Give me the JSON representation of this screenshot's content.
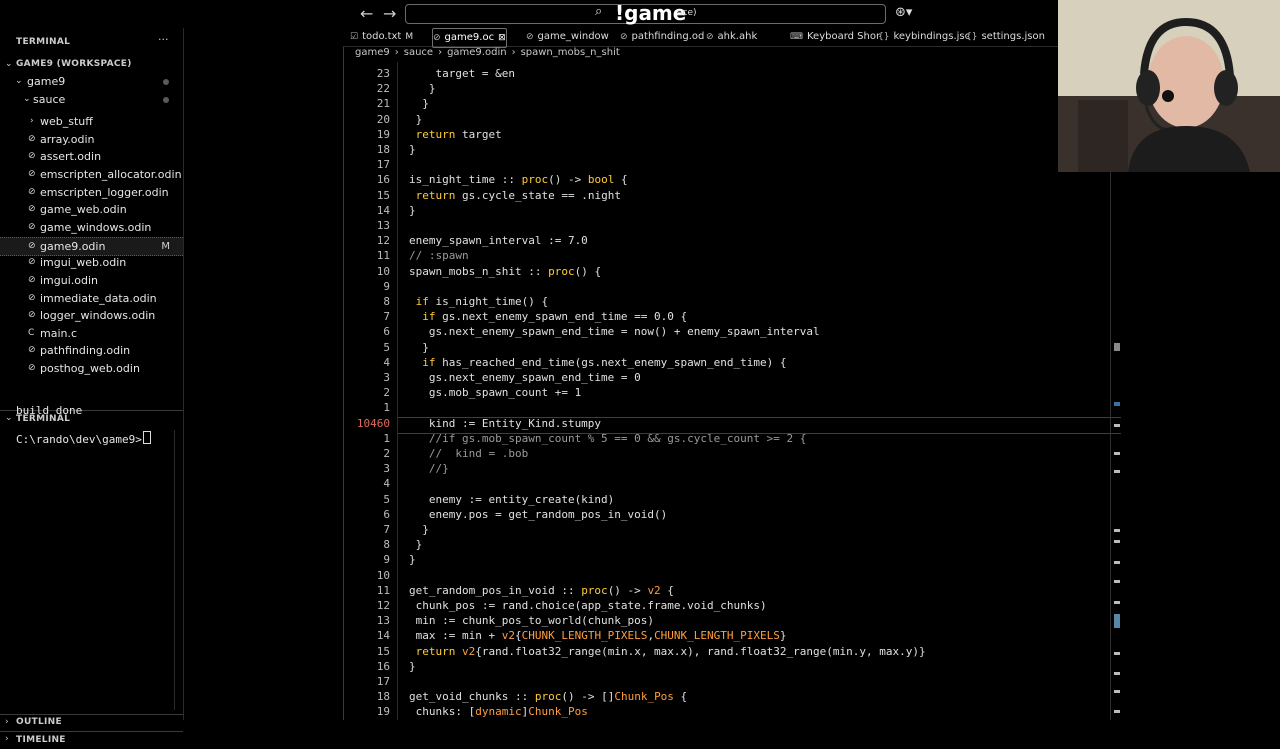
{
  "titlebar": {
    "back_glyph": "←",
    "forward_glyph": "→",
    "search_logo": "!game",
    "search_fragment": "ace)",
    "copilot_glyph": "⊛▾"
  },
  "sidebar": {
    "terminal_title": "TERMINAL",
    "more_glyph": "···",
    "workspace_label": "GAME9 (WORKSPACE)",
    "folders": [
      {
        "label": "game9"
      },
      {
        "label": "sauce"
      }
    ],
    "files": [
      {
        "label": "web_stuff",
        "icon": "›"
      },
      {
        "label": "array.odin",
        "icon": "⊘"
      },
      {
        "label": "assert.odin",
        "icon": "⊘"
      },
      {
        "label": "emscripten_allocator.odin",
        "icon": "⊘"
      },
      {
        "label": "emscripten_logger.odin",
        "icon": "⊘"
      },
      {
        "label": "game_web.odin",
        "icon": "⊘"
      },
      {
        "label": "game_windows.odin",
        "icon": "⊘"
      },
      {
        "label": "game9.odin",
        "icon": "⊘",
        "badge": "M"
      },
      {
        "label": "imgui_web.odin",
        "icon": "⊘"
      },
      {
        "label": "imgui.odin",
        "icon": "⊘"
      },
      {
        "label": "immediate_data.odin",
        "icon": "⊘"
      },
      {
        "label": "logger_windows.odin",
        "icon": "⊘"
      },
      {
        "label": "main.c",
        "icon": "C"
      },
      {
        "label": "pathfinding.odin",
        "icon": "⊘"
      },
      {
        "label": "posthog_web.odin",
        "icon": "⊘"
      }
    ],
    "terminal_section_label": "TERMINAL",
    "terminal_output": "build done",
    "terminal_prompt": "C:\\rando\\dev\\game9>",
    "outline_label": "OUTLINE",
    "timeline_label": "TIMELINE"
  },
  "tabs": [
    {
      "label": "todo.txt",
      "suffix": "M",
      "icon": "☑"
    },
    {
      "label": "game9.oc",
      "suffix": "⊠",
      "icon": "⊘",
      "active": true
    },
    {
      "label": "game_window",
      "icon": "⊘"
    },
    {
      "label": "pathfinding.od",
      "icon": "⊘"
    },
    {
      "label": "ahk.ahk",
      "icon": "⊘"
    },
    {
      "label": "Keyboard Shor",
      "icon": "⌨"
    },
    {
      "label": "keybindings.jsc",
      "icon": "{}"
    },
    {
      "label": "settings.json",
      "icon": "{}"
    }
  ],
  "breadcrumb": {
    "parts": [
      "game9",
      "sauce",
      "game9.odin",
      "spawn_mobs_n_shit"
    ],
    "separator": "›"
  },
  "code": {
    "line_numbers": [
      "23",
      "22",
      "21",
      "20",
      "19",
      "18",
      "17",
      "16",
      "15",
      "14",
      "13",
      "12",
      "11",
      "10",
      "9",
      "8",
      "7",
      "6",
      "5",
      "4",
      "3",
      "2",
      "1",
      "10460",
      "1",
      "2",
      "3",
      "4",
      "5",
      "6",
      "7",
      "8",
      "9",
      "10",
      "11",
      "12",
      "13",
      "14",
      "15",
      "16",
      "17",
      "18",
      "19"
    ],
    "lines": [
      "    target = &en",
      "   }",
      "  }",
      " }",
      " return target",
      "}",
      "",
      "is_night_time :: proc() -> bool {",
      " return gs.cycle_state == .night",
      "}",
      "",
      "enemy_spawn_interval := 7.0",
      "// :spawn",
      "spawn_mobs_n_shit :: proc() {",
      "",
      " if is_night_time() {",
      "  if gs.next_enemy_spawn_end_time == 0.0 {",
      "   gs.next_enemy_spawn_end_time = now() + enemy_spawn_interval",
      "  }",
      "  if has_reached_end_time(gs.next_enemy_spawn_end_time) {",
      "   gs.next_enemy_spawn_end_time = 0",
      "   gs.mob_spawn_count += 1",
      "",
      "   kind := Entity_Kind.stumpy",
      "   //if gs.mob_spawn_count % 5 == 0 && gs.cycle_count >= 2 {",
      "   //  kind = .bob",
      "   //}",
      "",
      "   enemy := entity_create(kind)",
      "   enemy.pos = get_random_pos_in_void()",
      "  }",
      " }",
      "}",
      "",
      "get_random_pos_in_void :: proc() -> v2 {",
      " chunk_pos := rand.choice(app_state.frame.void_chunks)",
      " min := chunk_pos_to_world(chunk_pos)",
      " max := min + v2{CHUNK_LENGTH_PIXELS,CHUNK_LENGTH_PIXELS}",
      " return v2{rand.float32_range(min.x, max.x), rand.float32_range(min.y, max.y)}",
      "}",
      "",
      "get_void_chunks :: proc() -> []Chunk_Pos {",
      " chunks: [dynamic]Chunk_Pos"
    ]
  },
  "colors": {
    "keyword": "#ffcc33",
    "type": "#ff9e3d",
    "comment": "#9a9a9a",
    "current_line_number": "#e06b5b"
  }
}
